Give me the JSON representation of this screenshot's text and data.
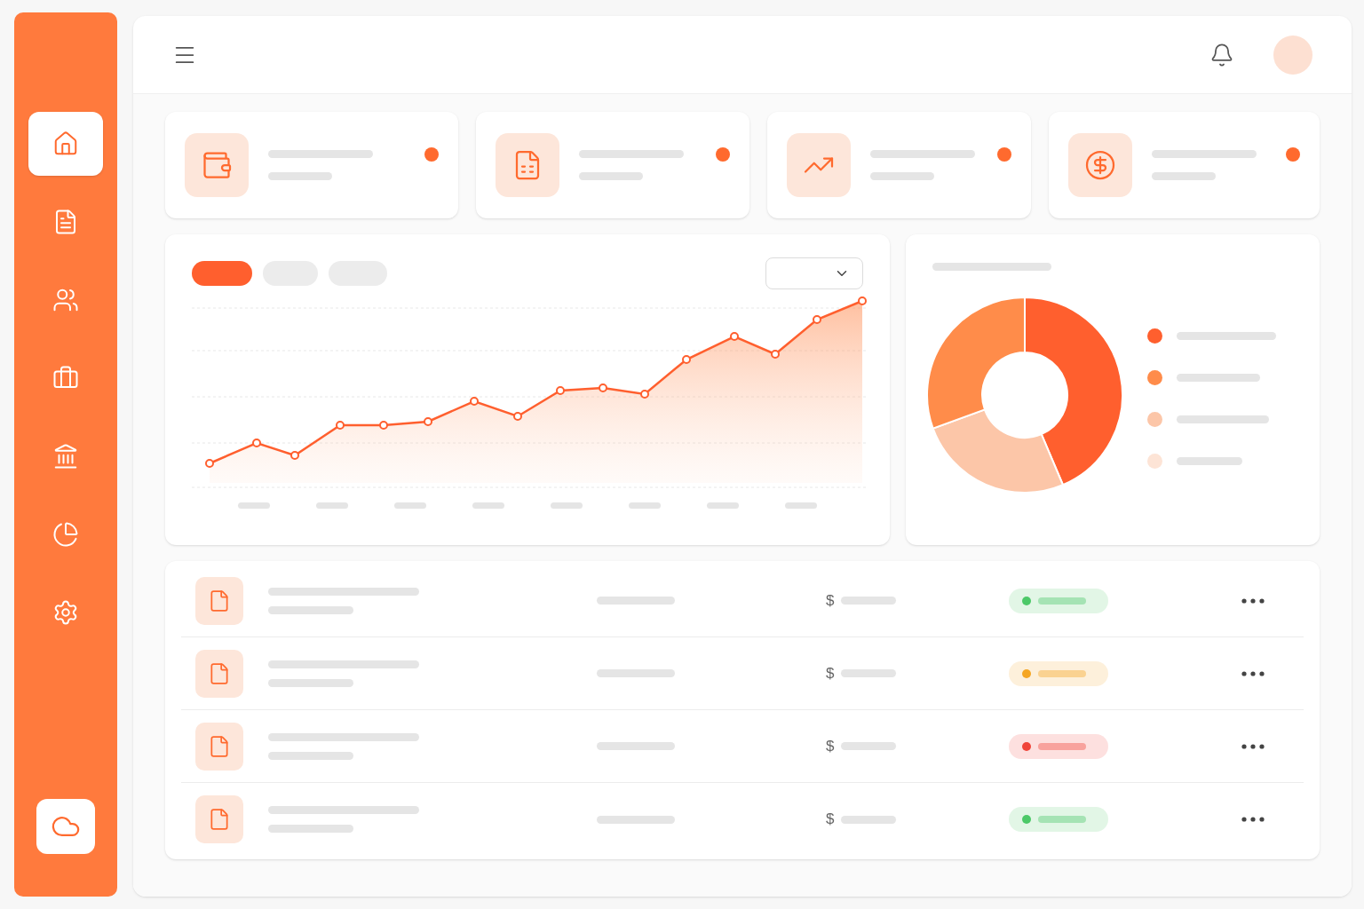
{
  "sidebar": {
    "items": [
      {
        "kind": "home",
        "selected": true
      },
      {
        "kind": "document",
        "selected": false
      },
      {
        "kind": "users",
        "selected": false
      },
      {
        "kind": "briefcase",
        "selected": false
      },
      {
        "kind": "bank",
        "selected": false
      },
      {
        "kind": "pie",
        "selected": false
      },
      {
        "kind": "settings",
        "selected": false
      }
    ],
    "footer": {
      "kind": "cloud"
    }
  },
  "stat_cards": [
    {
      "kind": "wallet"
    },
    {
      "kind": "invoice"
    },
    {
      "kind": "growth"
    },
    {
      "kind": "dollar"
    }
  ],
  "chart_tabs": [
    {
      "selected": true
    },
    {
      "selected": false
    },
    {
      "selected": false
    }
  ],
  "legend": [
    {
      "color": "#ff5f2e"
    },
    {
      "color": "#ff8c4a"
    },
    {
      "color": "#fcc6a8"
    },
    {
      "color": "#fde4d6"
    }
  ],
  "rows": [
    {
      "currency": "$",
      "color": "#4cc968"
    },
    {
      "currency": "$",
      "color": "#f5a623"
    },
    {
      "currency": "$",
      "color": "#f0453a"
    },
    {
      "currency": "$",
      "color": "#4cc968"
    }
  ]
}
